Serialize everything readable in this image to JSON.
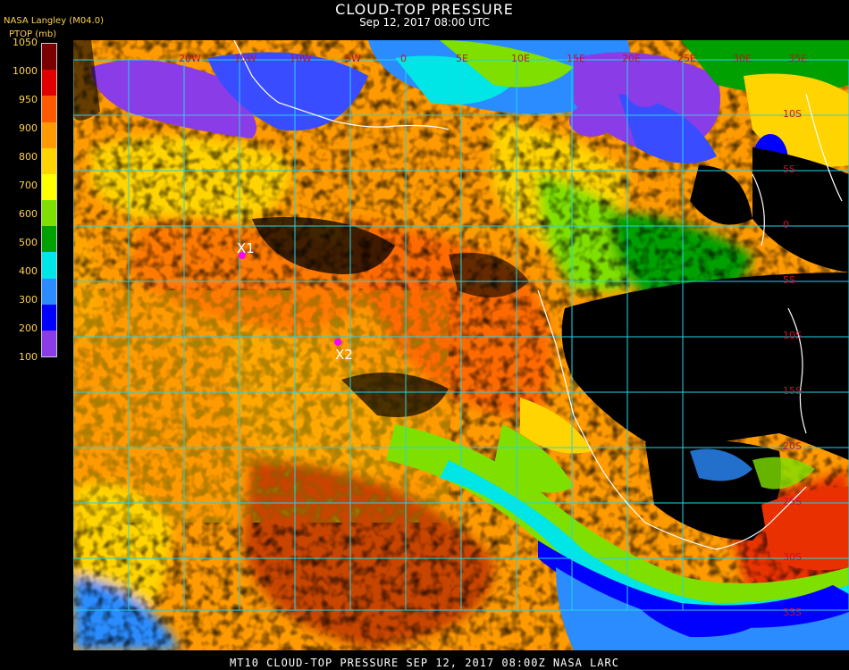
{
  "header": {
    "title": "CLOUD-TOP PRESSURE",
    "subtitle": "Sep 12, 2017 08:00 UTC",
    "source": "NASA Langley (M04.0)",
    "units": "PTOP (mb)"
  },
  "colorbar": {
    "ticks": [
      "1050",
      "1000",
      "950",
      "900",
      "800",
      "700",
      "600",
      "500",
      "400",
      "300",
      "200",
      "100"
    ],
    "colors": [
      "#7a0000",
      "#e00000",
      "#ff5a00",
      "#ff9a00",
      "#ffd400",
      "#ffff00",
      "#7fe000",
      "#00a000",
      "#00e6e6",
      "#2a8cff",
      "#0000ff",
      "#8a3ce6"
    ]
  },
  "map": {
    "lon_labels": [
      "20W",
      "15W",
      "10W",
      "5W",
      "0",
      "5E",
      "10E",
      "15E",
      "20E",
      "25E",
      "30E",
      "35E"
    ],
    "lat_labels": [
      "10S",
      "5S",
      "0",
      "5S",
      "10S",
      "15S",
      "20S",
      "25S",
      "30S",
      "35S"
    ],
    "markers": [
      {
        "label": "X1"
      },
      {
        "label": "X2"
      }
    ],
    "colors": {
      "grid": "#22d3e8",
      "land_outline": "#ffffff",
      "marker": "#ff00ff"
    }
  },
  "footer": "MT10  CLOUD-TOP PRESSURE  SEP 12, 2017 08:00Z  NASA LARC"
}
